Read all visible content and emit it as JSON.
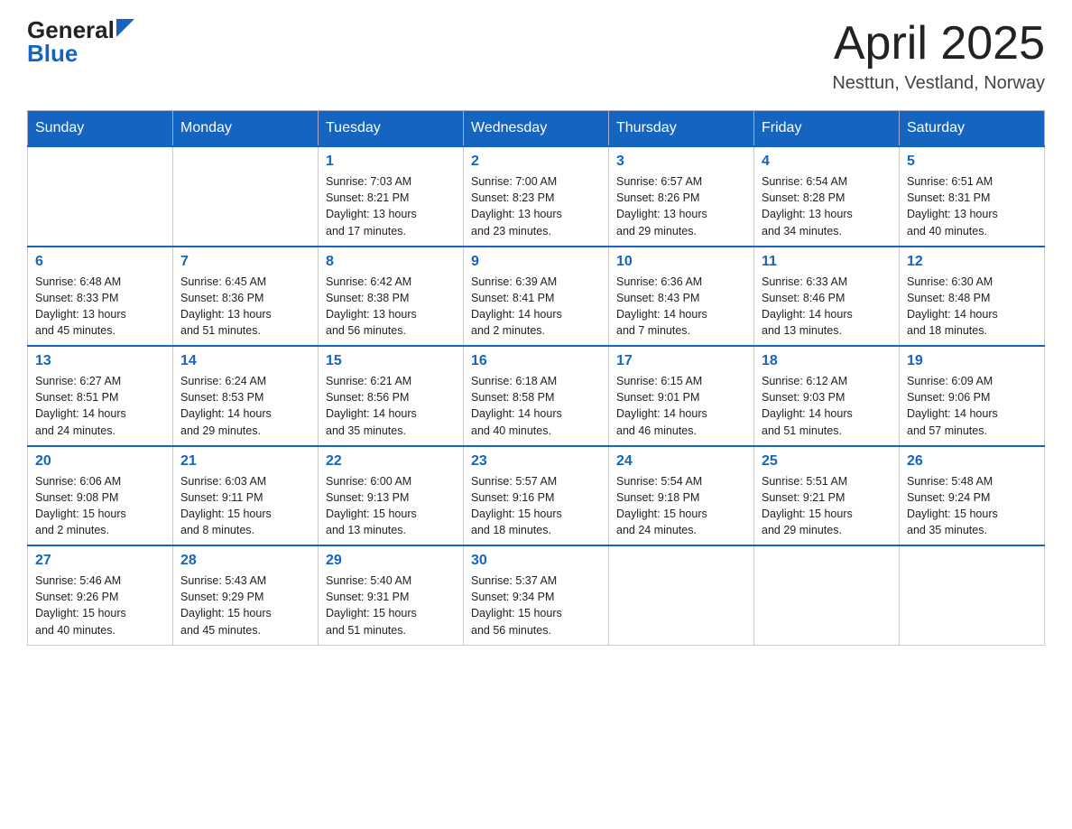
{
  "header": {
    "logo_general": "General",
    "logo_blue": "Blue",
    "title": "April 2025",
    "subtitle": "Nesttun, Vestland, Norway"
  },
  "weekdays": [
    "Sunday",
    "Monday",
    "Tuesday",
    "Wednesday",
    "Thursday",
    "Friday",
    "Saturday"
  ],
  "weeks": [
    [
      {
        "day": "",
        "info": ""
      },
      {
        "day": "",
        "info": ""
      },
      {
        "day": "1",
        "info": "Sunrise: 7:03 AM\nSunset: 8:21 PM\nDaylight: 13 hours\nand 17 minutes."
      },
      {
        "day": "2",
        "info": "Sunrise: 7:00 AM\nSunset: 8:23 PM\nDaylight: 13 hours\nand 23 minutes."
      },
      {
        "day": "3",
        "info": "Sunrise: 6:57 AM\nSunset: 8:26 PM\nDaylight: 13 hours\nand 29 minutes."
      },
      {
        "day": "4",
        "info": "Sunrise: 6:54 AM\nSunset: 8:28 PM\nDaylight: 13 hours\nand 34 minutes."
      },
      {
        "day": "5",
        "info": "Sunrise: 6:51 AM\nSunset: 8:31 PM\nDaylight: 13 hours\nand 40 minutes."
      }
    ],
    [
      {
        "day": "6",
        "info": "Sunrise: 6:48 AM\nSunset: 8:33 PM\nDaylight: 13 hours\nand 45 minutes."
      },
      {
        "day": "7",
        "info": "Sunrise: 6:45 AM\nSunset: 8:36 PM\nDaylight: 13 hours\nand 51 minutes."
      },
      {
        "day": "8",
        "info": "Sunrise: 6:42 AM\nSunset: 8:38 PM\nDaylight: 13 hours\nand 56 minutes."
      },
      {
        "day": "9",
        "info": "Sunrise: 6:39 AM\nSunset: 8:41 PM\nDaylight: 14 hours\nand 2 minutes."
      },
      {
        "day": "10",
        "info": "Sunrise: 6:36 AM\nSunset: 8:43 PM\nDaylight: 14 hours\nand 7 minutes."
      },
      {
        "day": "11",
        "info": "Sunrise: 6:33 AM\nSunset: 8:46 PM\nDaylight: 14 hours\nand 13 minutes."
      },
      {
        "day": "12",
        "info": "Sunrise: 6:30 AM\nSunset: 8:48 PM\nDaylight: 14 hours\nand 18 minutes."
      }
    ],
    [
      {
        "day": "13",
        "info": "Sunrise: 6:27 AM\nSunset: 8:51 PM\nDaylight: 14 hours\nand 24 minutes."
      },
      {
        "day": "14",
        "info": "Sunrise: 6:24 AM\nSunset: 8:53 PM\nDaylight: 14 hours\nand 29 minutes."
      },
      {
        "day": "15",
        "info": "Sunrise: 6:21 AM\nSunset: 8:56 PM\nDaylight: 14 hours\nand 35 minutes."
      },
      {
        "day": "16",
        "info": "Sunrise: 6:18 AM\nSunset: 8:58 PM\nDaylight: 14 hours\nand 40 minutes."
      },
      {
        "day": "17",
        "info": "Sunrise: 6:15 AM\nSunset: 9:01 PM\nDaylight: 14 hours\nand 46 minutes."
      },
      {
        "day": "18",
        "info": "Sunrise: 6:12 AM\nSunset: 9:03 PM\nDaylight: 14 hours\nand 51 minutes."
      },
      {
        "day": "19",
        "info": "Sunrise: 6:09 AM\nSunset: 9:06 PM\nDaylight: 14 hours\nand 57 minutes."
      }
    ],
    [
      {
        "day": "20",
        "info": "Sunrise: 6:06 AM\nSunset: 9:08 PM\nDaylight: 15 hours\nand 2 minutes."
      },
      {
        "day": "21",
        "info": "Sunrise: 6:03 AM\nSunset: 9:11 PM\nDaylight: 15 hours\nand 8 minutes."
      },
      {
        "day": "22",
        "info": "Sunrise: 6:00 AM\nSunset: 9:13 PM\nDaylight: 15 hours\nand 13 minutes."
      },
      {
        "day": "23",
        "info": "Sunrise: 5:57 AM\nSunset: 9:16 PM\nDaylight: 15 hours\nand 18 minutes."
      },
      {
        "day": "24",
        "info": "Sunrise: 5:54 AM\nSunset: 9:18 PM\nDaylight: 15 hours\nand 24 minutes."
      },
      {
        "day": "25",
        "info": "Sunrise: 5:51 AM\nSunset: 9:21 PM\nDaylight: 15 hours\nand 29 minutes."
      },
      {
        "day": "26",
        "info": "Sunrise: 5:48 AM\nSunset: 9:24 PM\nDaylight: 15 hours\nand 35 minutes."
      }
    ],
    [
      {
        "day": "27",
        "info": "Sunrise: 5:46 AM\nSunset: 9:26 PM\nDaylight: 15 hours\nand 40 minutes."
      },
      {
        "day": "28",
        "info": "Sunrise: 5:43 AM\nSunset: 9:29 PM\nDaylight: 15 hours\nand 45 minutes."
      },
      {
        "day": "29",
        "info": "Sunrise: 5:40 AM\nSunset: 9:31 PM\nDaylight: 15 hours\nand 51 minutes."
      },
      {
        "day": "30",
        "info": "Sunrise: 5:37 AM\nSunset: 9:34 PM\nDaylight: 15 hours\nand 56 minutes."
      },
      {
        "day": "",
        "info": ""
      },
      {
        "day": "",
        "info": ""
      },
      {
        "day": "",
        "info": ""
      }
    ]
  ]
}
